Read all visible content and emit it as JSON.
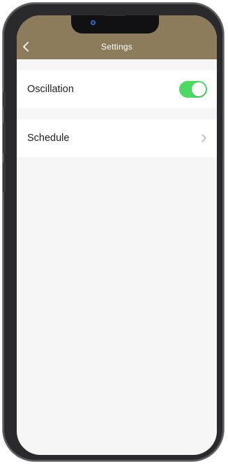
{
  "header": {
    "title": "Settings",
    "background_color": "#8c7c5b",
    "back_icon": "chevron-left-icon"
  },
  "settings": {
    "oscillation": {
      "label": "Oscillation",
      "enabled": true,
      "toggle_color": "#4cd964"
    },
    "schedule": {
      "label": "Schedule",
      "icon": "chevron-right-icon"
    }
  }
}
